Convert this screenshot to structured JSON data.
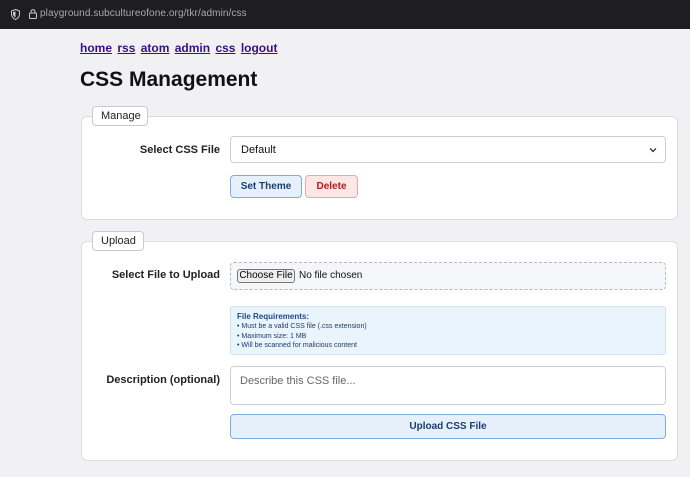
{
  "browser": {
    "url_host": "playground.subcultureofone.org",
    "url_path": "/tkr/admin/css"
  },
  "nav": {
    "items": [
      "home",
      "rss",
      "atom",
      "admin",
      "css",
      "logout"
    ]
  },
  "page": {
    "title": "CSS Management"
  },
  "manage": {
    "legend": "Manage",
    "select_label": "Select CSS File",
    "selected_value": "Default",
    "set_theme_label": "Set Theme",
    "delete_label": "Delete"
  },
  "upload": {
    "legend": "Upload",
    "file_label": "Select File to Upload",
    "choose_label": "Choose File",
    "no_file_text": "No file chosen",
    "requirements": {
      "title": "File Requirements:",
      "items": [
        "• Must be a valid CSS file (.css extension)",
        "• Maximum size: 1 MB",
        "• Will be scanned for malicious content"
      ]
    },
    "description_label": "Description (optional)",
    "description_placeholder": "Describe this CSS file...",
    "upload_button_label": "Upload CSS File"
  },
  "colors": {
    "link": "#3a0e86",
    "primary_button_bg": "#e6f0fb",
    "primary_button_border": "#79aee0",
    "danger_button_bg": "#fde6e6",
    "danger_text": "#b01e1e",
    "info_bg": "#eaf4fd"
  },
  "icons": {
    "tracking": "shield-icon",
    "security": "lock-icon",
    "select": "chevron-down-icon"
  }
}
